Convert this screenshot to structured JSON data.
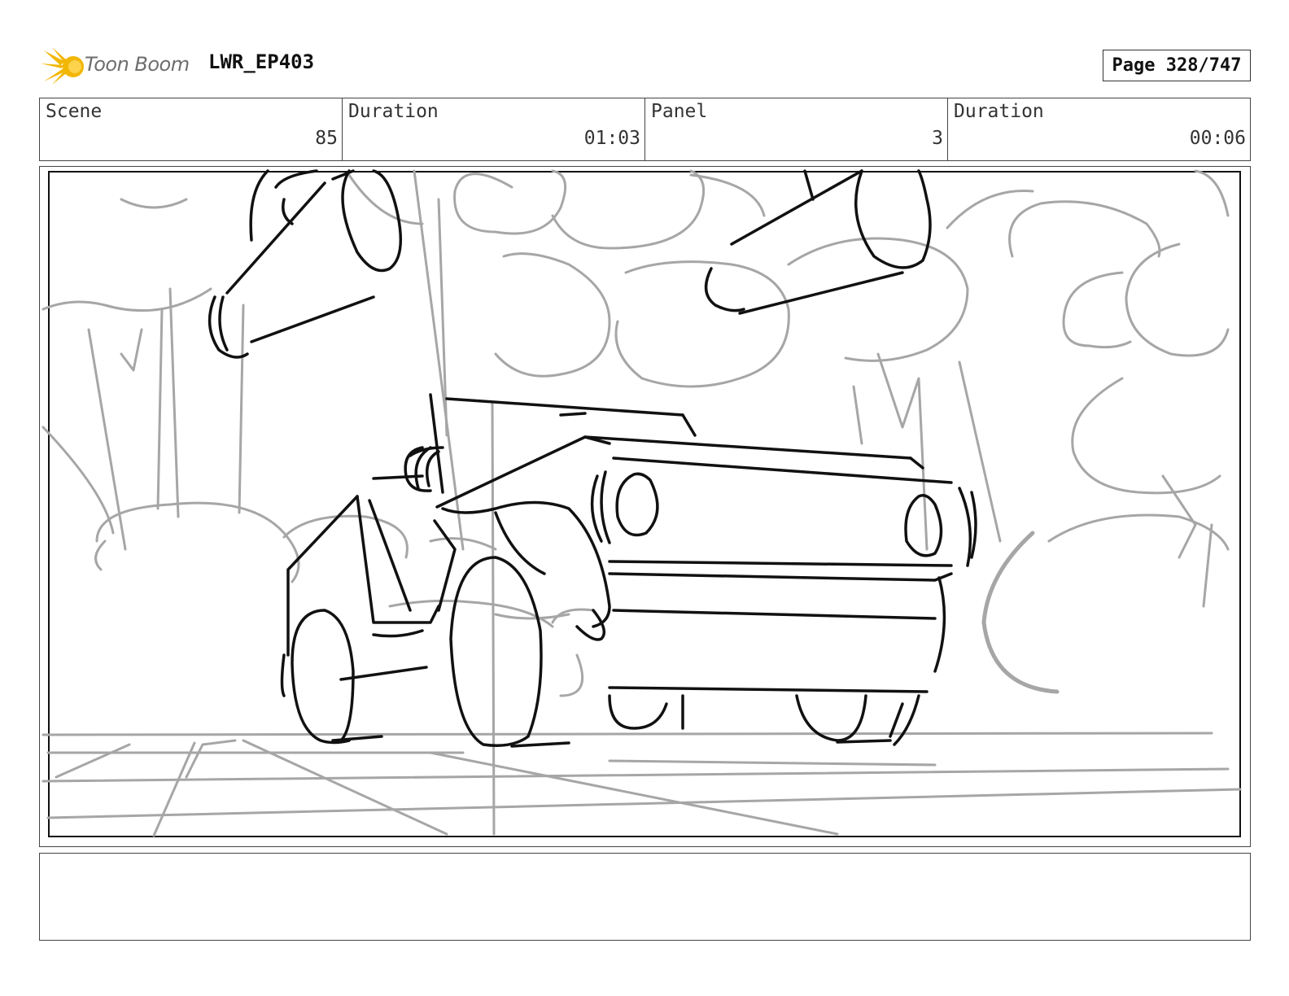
{
  "header": {
    "logo_text": "Toon Boom",
    "project_title": "LWR_EP403",
    "page_label": "Page 328/747"
  },
  "info": {
    "scene_label": "Scene",
    "scene_value": "85",
    "scene_duration_label": "Duration",
    "scene_duration_value": "01:03",
    "panel_label": "Panel",
    "panel_value": "3",
    "panel_duration_label": "Duration",
    "panel_duration_value": "00:06"
  },
  "colors": {
    "logo_accent": "#f2b705",
    "sketch_dark": "#111111",
    "sketch_light": "#a6a6a6"
  },
  "notes": {
    "text": ""
  }
}
